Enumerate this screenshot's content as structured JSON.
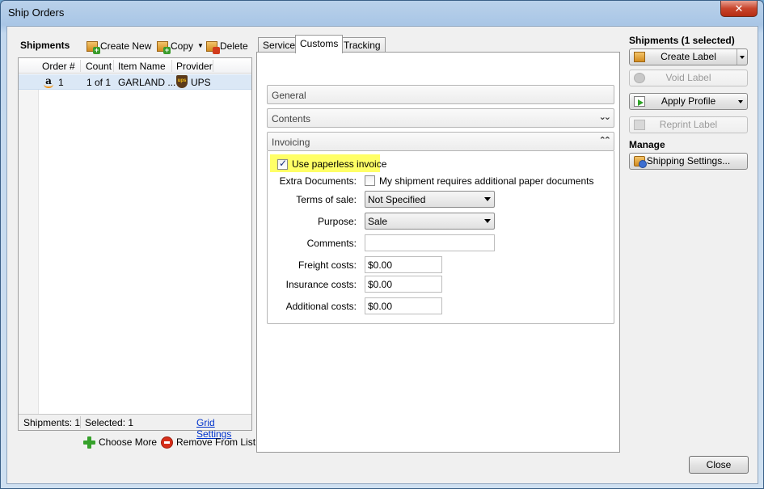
{
  "window": {
    "title": "Ship Orders",
    "close_glyph": "✕"
  },
  "left": {
    "title": "Shipments",
    "toolbar": {
      "create_new": "Create New",
      "copy": "Copy",
      "delete": "Delete"
    },
    "columns": [
      "Order #",
      "Count",
      "Item Name",
      "Provider"
    ],
    "rows": [
      {
        "order": "1",
        "count": "1 of 1",
        "item": "GARLAND ...",
        "provider": "UPS",
        "store_icon": "amazon-icon",
        "provider_icon": "ups-icon"
      }
    ],
    "footer": {
      "shipments": "Shipments: 1",
      "selected": "Selected: 1",
      "grid_settings": "Grid Settings"
    },
    "choose_more": "Choose More",
    "remove_from_list": "Remove From List"
  },
  "tabs": [
    "Service",
    "Customs",
    "Tracking"
  ],
  "active_tab": "Customs",
  "sections": {
    "general": "General",
    "contents": "Contents",
    "invoicing": "Invoicing"
  },
  "invoicing": {
    "paperless_label": "Use paperless invoice",
    "paperless_checked": true,
    "extra_docs_label": "Extra Documents:",
    "extra_docs_text": "My shipment requires additional paper documents",
    "extra_docs_checked": false,
    "terms_label": "Terms of sale:",
    "terms_value": "Not Specified",
    "purpose_label": "Purpose:",
    "purpose_value": "Sale",
    "comments_label": "Comments:",
    "comments_value": "",
    "freight_label": "Freight costs:",
    "freight_value": "$0.00",
    "insurance_label": "Insurance costs:",
    "insurance_value": "$0.00",
    "additional_label": "Additional costs:",
    "additional_value": "$0.00"
  },
  "right": {
    "title": "Shipments (1 selected)",
    "create_label": "Create Label",
    "void_label": "Void Label",
    "apply_profile": "Apply Profile",
    "reprint_label": "Reprint Label",
    "manage_title": "Manage",
    "shipping_settings": "Shipping Settings..."
  },
  "close_button": "Close",
  "colors": {
    "highlight": "#ffff66",
    "selected_row": "#dbe8f6",
    "link": "#0033cc"
  }
}
